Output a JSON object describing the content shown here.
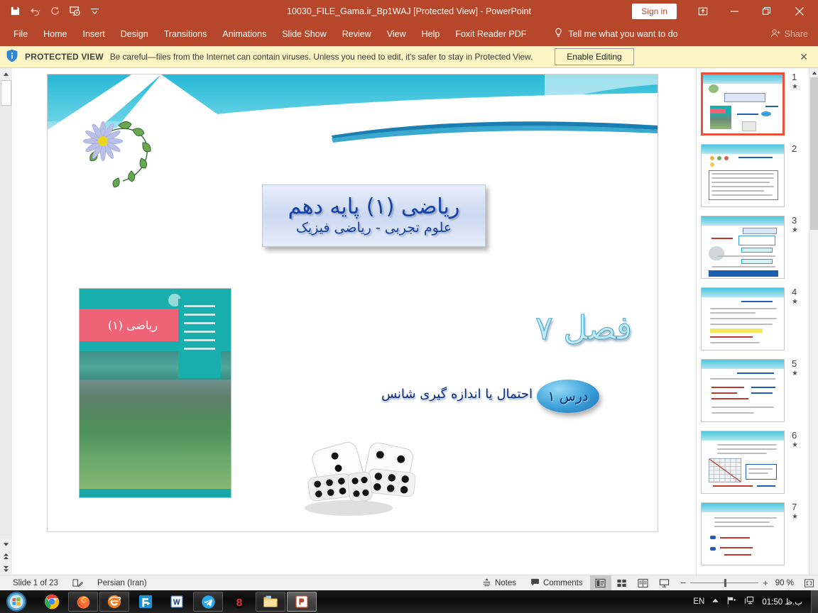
{
  "titlebar": {
    "document_title": "10030_FILE_Gama.ir_Bp1WAJ [Protected View]  -  PowerPoint",
    "signin_label": "Sign in",
    "qat": [
      {
        "name": "save-icon",
        "label": "Save"
      },
      {
        "name": "undo-icon",
        "label": "Undo"
      },
      {
        "name": "redo-icon",
        "label": "Redo"
      },
      {
        "name": "start-presentation-icon",
        "label": "Start From Beginning"
      },
      {
        "name": "customize-qat-icon",
        "label": "Customize Quick Access Toolbar"
      }
    ],
    "window_buttons": [
      {
        "name": "ribbon-display-options-icon",
        "glyph": "⤒"
      },
      {
        "name": "minimize-icon",
        "glyph": "—"
      },
      {
        "name": "restore-icon",
        "glyph": "❐"
      },
      {
        "name": "close-icon",
        "glyph": "✕"
      }
    ]
  },
  "ribbon": {
    "tabs": [
      "File",
      "Home",
      "Insert",
      "Design",
      "Transitions",
      "Animations",
      "Slide Show",
      "Review",
      "View",
      "Help",
      "Foxit Reader PDF"
    ],
    "tell_me": "Tell me what you want to do",
    "share_label": "Share"
  },
  "protected_view": {
    "label": "PROTECTED VIEW",
    "message": "Be careful—files from the Internet can contain viruses. Unless you need to edit, it's safer to stay in Protected View.",
    "button": "Enable Editing",
    "close_glyph": "✕"
  },
  "slide": {
    "title_line1": "ریاضی (۱) پایه دهم",
    "title_line2": "علوم تجربی - ریاضی فیزیک",
    "chapter": "فصل ۷",
    "lesson_badge": "درس ۱",
    "lesson_subtitle": "احتمال یا اندازه گیری شانس",
    "book_cover_title": "ریاضی (۱)",
    "colors": {
      "band_cyan": "#27b9d6",
      "title_text": "#1442a5",
      "chapter_text": "#bfecfb",
      "book_teal": "#19aeae",
      "book_pink": "#ee6376"
    }
  },
  "thumbnails": {
    "scroll_up_glyph": "▲",
    "scroll_down_glyph": "▼",
    "items": [
      {
        "number": "1",
        "animated": true,
        "selected": true,
        "kind": "title"
      },
      {
        "number": "2",
        "animated": false,
        "selected": false,
        "kind": "text"
      },
      {
        "number": "3",
        "animated": true,
        "selected": false,
        "kind": "diagram"
      },
      {
        "number": "4",
        "animated": true,
        "selected": false,
        "kind": "text"
      },
      {
        "number": "5",
        "animated": true,
        "selected": false,
        "kind": "list"
      },
      {
        "number": "6",
        "animated": true,
        "selected": false,
        "kind": "grid"
      },
      {
        "number": "7",
        "animated": true,
        "selected": false,
        "kind": "formula"
      }
    ],
    "star_glyph": "★"
  },
  "statusbar": {
    "slide_counter": "Slide 1 of 23",
    "language": "Persian (Iran)",
    "notes_label": "Notes",
    "comments_label": "Comments",
    "zoom_percent": "90 %",
    "zoom_minus": "−",
    "zoom_plus": "+",
    "views": [
      {
        "name": "normal-view-button",
        "active": true
      },
      {
        "name": "slide-sorter-view-button",
        "active": false
      },
      {
        "name": "reading-view-button",
        "active": false
      },
      {
        "name": "slideshow-view-button",
        "active": false
      }
    ]
  },
  "taskbar": {
    "apps": [
      {
        "name": "start-button",
        "label": "Start"
      },
      {
        "name": "taskbar-chrome",
        "label": "Google Chrome"
      },
      {
        "name": "taskbar-firefox",
        "label": "Mozilla Firefox"
      },
      {
        "name": "taskbar-internet-explorer",
        "label": "Internet Explorer"
      },
      {
        "name": "taskbar-foxit-reader",
        "label": "Foxit Reader"
      },
      {
        "name": "taskbar-word",
        "label": "Microsoft Word"
      },
      {
        "name": "taskbar-telegram",
        "label": "Telegram"
      },
      {
        "name": "taskbar-eitaa",
        "label": "Eitaa"
      },
      {
        "name": "taskbar-file-explorer",
        "label": "File Explorer"
      },
      {
        "name": "taskbar-powerpoint",
        "label": "Microsoft PowerPoint"
      }
    ],
    "tray_language": "EN",
    "clock": "01:50 ب.ظ"
  }
}
